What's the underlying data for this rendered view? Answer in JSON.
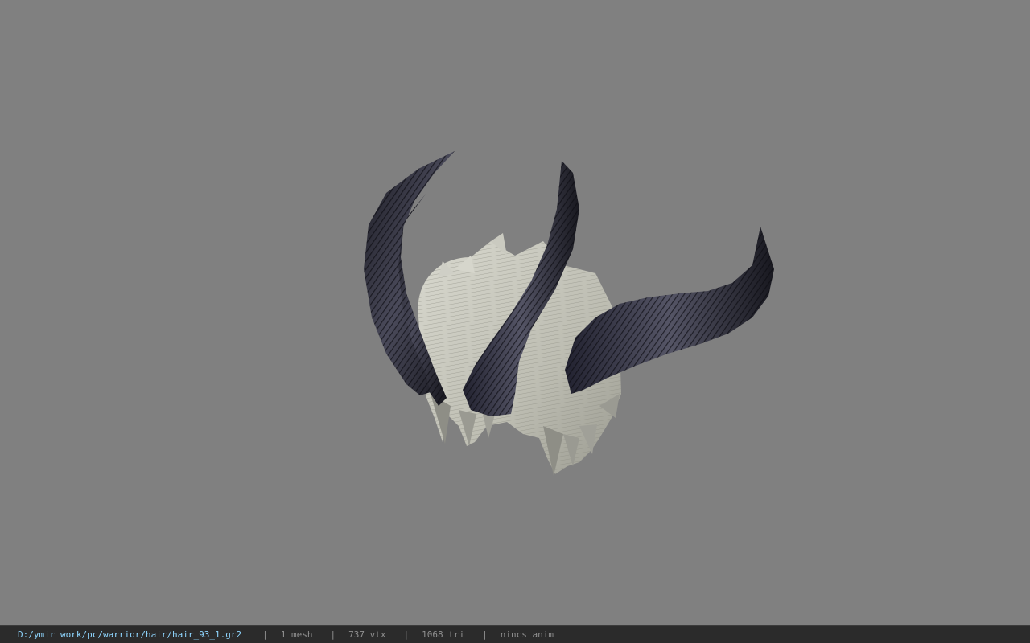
{
  "viewer": {
    "background_color": "#808080",
    "model_icon": "horned-hair-model-icon"
  },
  "status": {
    "file_path": "D:/ymir work/pc/warrior/hair/hair_93_1.gr2",
    "separator": "|",
    "mesh_count": "1 mesh",
    "vertex_count": "737 vtx",
    "triangle_count": "1068 tri",
    "anim_status": "nincs anim"
  },
  "colors": {
    "statusbar_bg": "#2b2b2b",
    "path_text": "#8fd6ff",
    "info_text": "#8f8f8f"
  }
}
